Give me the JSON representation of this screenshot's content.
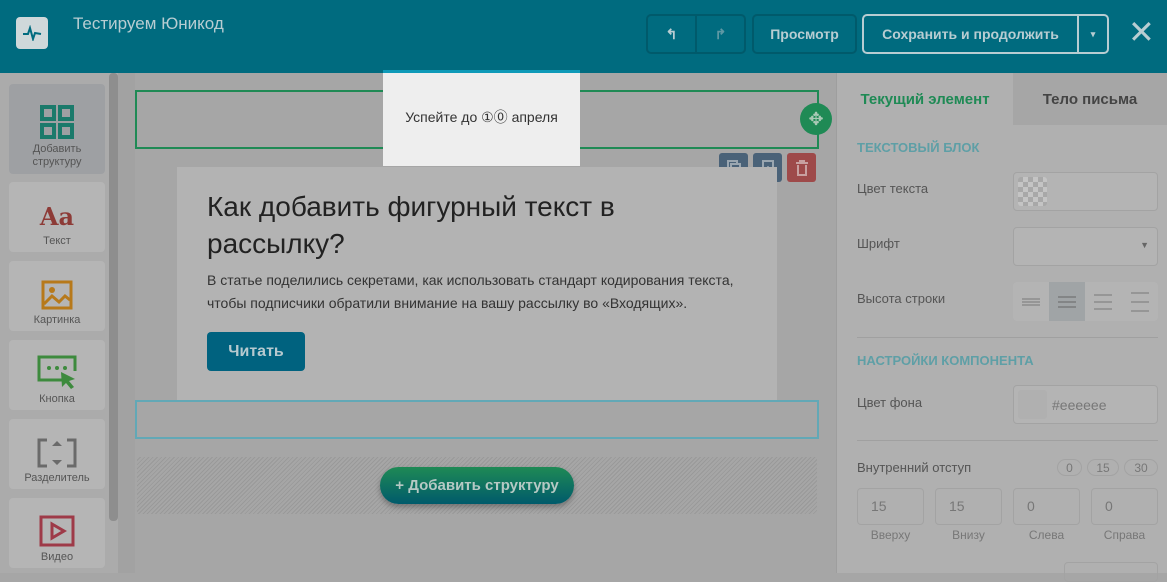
{
  "header": {
    "title": "Тестируем Юникод",
    "preview": "Просмотр",
    "save": "Сохранить и продолжить"
  },
  "sidebar": {
    "items": [
      {
        "label": "Добавить структуру"
      },
      {
        "label": "Текст",
        "icon_text": "Aa"
      },
      {
        "label": "Картинка"
      },
      {
        "label": "Кнопка"
      },
      {
        "label": "Разделитель"
      },
      {
        "label": "Видео"
      }
    ]
  },
  "canvas": {
    "highlight_text": "Успейте до ①⓪ апреля",
    "card_title": "Как добавить фигурный текст в рассылку?",
    "card_text": "В статье поделились секретами, как использовать стандарт кодирования текста, чтобы подписчики обратили внимание на вашу рассылку во «Входящих».",
    "read_button": "Читать",
    "add_structure": "+ Добавить структуру"
  },
  "panel": {
    "tabs": [
      "Текущий элемент",
      "Тело письма"
    ],
    "text_block": "ТЕКСТОВЫЙ БЛОК",
    "text_color": "Цвет текста",
    "font": "Шрифт",
    "line_height": "Высота строки",
    "component_settings": "НАСТРОЙКИ КОМПОНЕНТА",
    "bg_color": "Цвет фона",
    "bg_value": "#eeeeee",
    "padding": "Внутренний отступ",
    "presets": [
      "0",
      "15",
      "30"
    ],
    "pads": [
      {
        "value": "15",
        "label": "Вверху"
      },
      {
        "value": "15",
        "label": "Внизу"
      },
      {
        "value": "0",
        "label": "Слева"
      },
      {
        "value": "0",
        "label": "Справа"
      }
    ]
  },
  "colors": {
    "header": "#006b7f",
    "accent": "#1f8a55"
  }
}
